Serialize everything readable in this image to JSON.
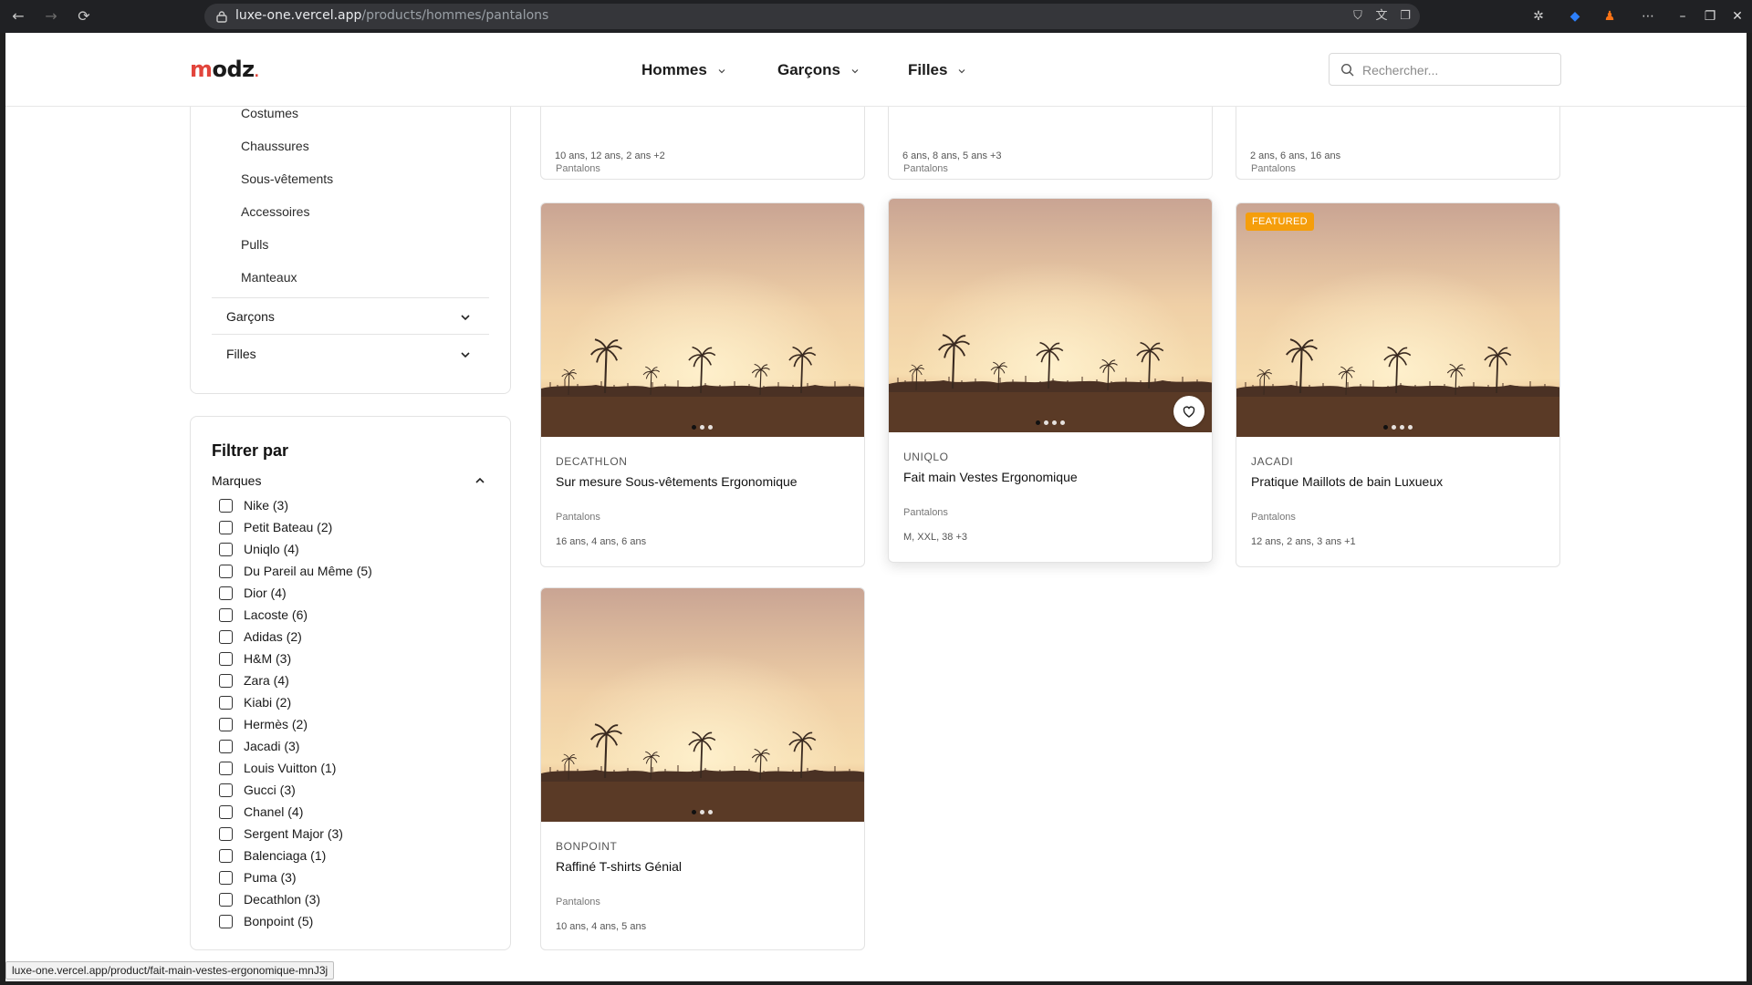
{
  "browser": {
    "url_host": "luxe-one.vercel.app",
    "url_path": "/products/hommes/pantalons",
    "status_url": "luxe-one.vercel.app/product/fait-main-vestes-ergonomique-mnJ3j"
  },
  "header": {
    "logo_m": "m",
    "logo_rest": "odz",
    "logo_dot": ".",
    "nav": [
      "Hommes",
      "Garçons",
      "Filles"
    ],
    "search_placeholder": "Rechercher..."
  },
  "sidebar": {
    "subcategories": [
      "Costumes",
      "Chaussures",
      "Sous-vêtements",
      "Accessoires",
      "Pulls",
      "Manteaux"
    ],
    "groups": [
      "Garçons",
      "Filles"
    ],
    "filter_title": "Filtrer par",
    "filter_group": "Marques",
    "brands": [
      "Nike (3)",
      "Petit Bateau (2)",
      "Uniqlo (4)",
      "Du Pareil au Même (5)",
      "Dior (4)",
      "Lacoste (6)",
      "Adidas (2)",
      "H&M (3)",
      "Zara (4)",
      "Kiabi (2)",
      "Hermès (2)",
      "Jacadi (3)",
      "Louis Vuitton (1)",
      "Gucci (3)",
      "Chanel (4)",
      "Sergent Major (3)",
      "Balenciaga (1)",
      "Puma (3)",
      "Decathlon (3)",
      "Bonpoint (5)"
    ]
  },
  "products_top_partial": [
    {
      "category": "Pantalons",
      "sizes": "10 ans, 12 ans, 2 ans +2"
    },
    {
      "category": "Pantalons",
      "sizes": "6 ans, 8 ans, 5 ans +3"
    },
    {
      "category": "Pantalons",
      "sizes": "2 ans, 6 ans, 16 ans"
    }
  ],
  "products": [
    {
      "brand": "DECATHLON",
      "name": "Sur mesure Sous-vêtements Ergonomique",
      "category": "Pantalons",
      "sizes": "16 ans, 4 ans, 6 ans",
      "image_count": 3,
      "featured": false
    },
    {
      "brand": "UNIQLO",
      "name": "Fait main Vestes Ergonomique",
      "category": "Pantalons",
      "sizes": "M, XXL, 38 +3",
      "image_count": 4,
      "featured": false
    },
    {
      "brand": "JACADI",
      "name": "Pratique Maillots de bain Luxueux",
      "category": "Pantalons",
      "sizes": "12 ans, 2 ans, 3 ans +1",
      "image_count": 4,
      "featured": true,
      "badge": "FEATURED"
    },
    {
      "brand": "BONPOINT",
      "name": "Raffiné T-shirts Génial",
      "category": "Pantalons",
      "sizes": "10 ans, 4 ans, 5 ans",
      "image_count": 3,
      "featured": false
    }
  ],
  "colors": {
    "accent": "#e2453c",
    "featured_badge": "#f59e0b"
  }
}
